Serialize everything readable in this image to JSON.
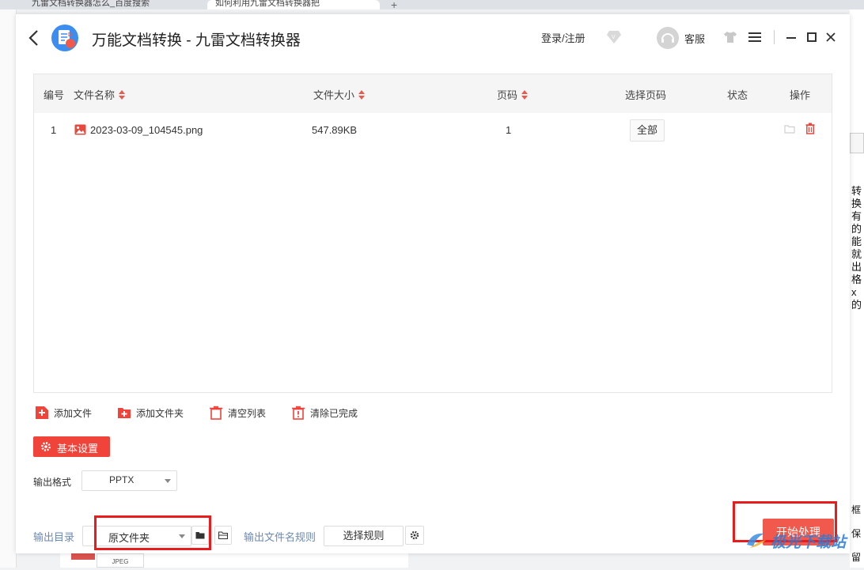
{
  "background": {
    "tab1": "九雷文档转换器怎么_百度搜索",
    "tab2": "如何利用九雷文档转换器把",
    "right_text": "转换有的能就出格x的",
    "right_text2": "框保留",
    "bottom_label": "JPEG"
  },
  "header": {
    "title": "万能文档转换 - 九雷文档转换器",
    "login": "登录/注册",
    "service": "客服"
  },
  "table": {
    "columns": {
      "index": "编号",
      "name": "文件名称",
      "size": "文件大小",
      "pages": "页码",
      "select_pages": "选择页码",
      "status": "状态",
      "action": "操作"
    },
    "rows": [
      {
        "index": "1",
        "name": "2023-03-09_104545.png",
        "size": "547.89KB",
        "pages": "1",
        "select_pages": "全部",
        "status": ""
      }
    ]
  },
  "toolbar": {
    "add_file": "添加文件",
    "add_folder": "添加文件夹",
    "clear_list": "清空列表",
    "clear_done": "清除已完成"
  },
  "settings": {
    "basic_settings": "基本设置",
    "output_format_label": "输出格式",
    "output_format_value": "PPTX",
    "output_dir_label": "输出目录",
    "output_dir_value": "原文件夹",
    "name_rule_label": "输出文件名规则",
    "select_rule": "选择规则",
    "start": "开始处理"
  },
  "watermark": "极光下载站",
  "colors": {
    "accent": "#f0433a",
    "highlight": "#e81c1c",
    "label_blue": "#6b8ab5"
  }
}
